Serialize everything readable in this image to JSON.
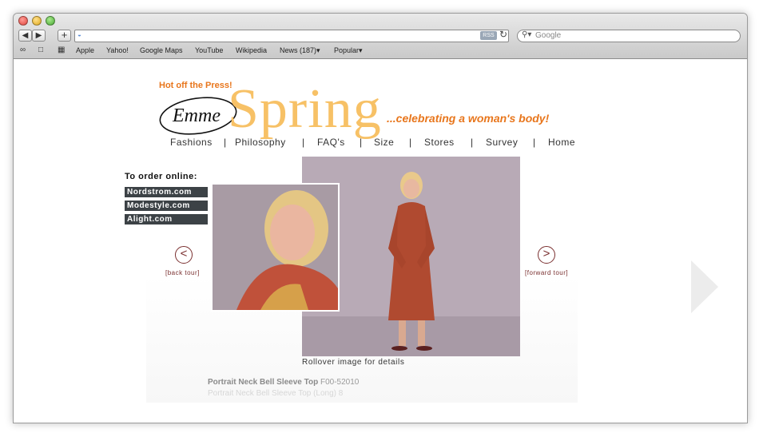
{
  "browser": {
    "rss_label": "RSS",
    "search_placeholder": "Google",
    "bookmarks": [
      {
        "label": "Apple"
      },
      {
        "label": "Yahoo!"
      },
      {
        "label": "Google Maps"
      },
      {
        "label": "YouTube"
      },
      {
        "label": "Wikipedia"
      },
      {
        "label": "News (187)▾"
      },
      {
        "label": "Popular▾"
      }
    ]
  },
  "page": {
    "press_text": "Hot off the Press!",
    "logo_text": "Emme",
    "season_title": "Spring",
    "tagline": "...celebrating a woman's body!",
    "nav": [
      "Fashions",
      "Philosophy",
      "FAQ's",
      "Size",
      "Stores",
      "Survey",
      "Home"
    ],
    "order_title": "To order online:",
    "stores": [
      "Nordstrom.com",
      "Modestyle.com",
      "Alight.com"
    ],
    "back_label": "[back tour]",
    "forward_label": "[forward tour]",
    "caption": "Rollover image for details",
    "product_name": "Portrait Neck Bell Sleeve Top",
    "product_code": "F00-52010",
    "product_line2": "Portrait Neck Bell Sleeve Top (Long) 8"
  },
  "colors": {
    "accent_orange": "#e8761c",
    "spring_yellow": "#f7c166",
    "store_bg": "#3c4246",
    "tour_red": "#7a2f2f"
  }
}
